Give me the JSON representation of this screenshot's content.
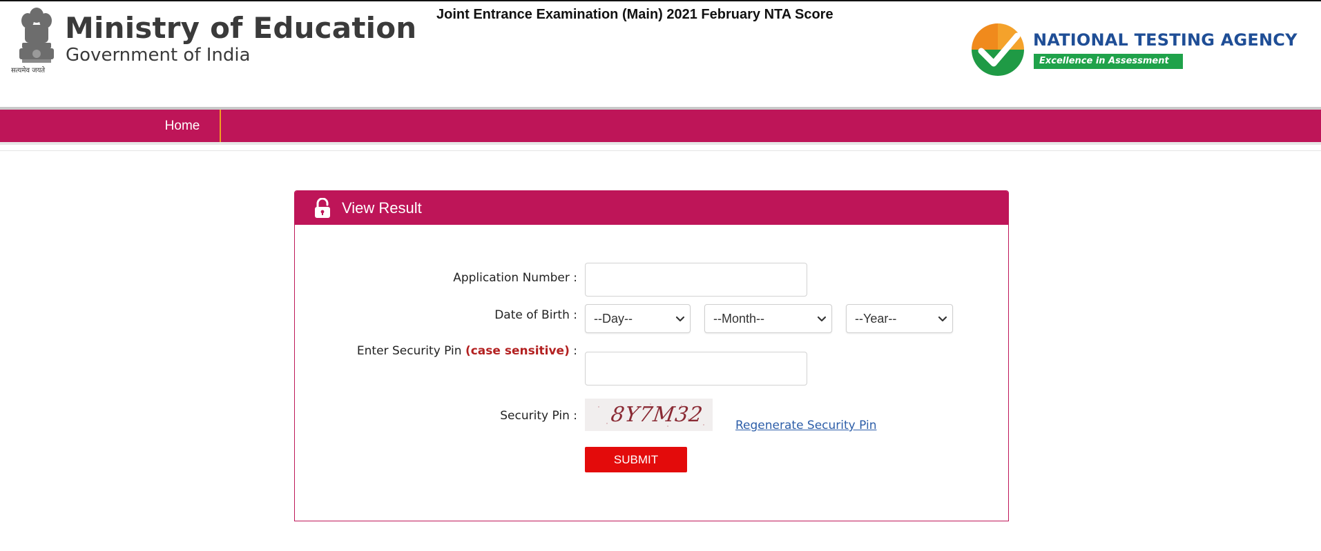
{
  "header": {
    "ministry_title": "Ministry of Education",
    "ministry_subtitle": "Government of India",
    "emblem_motto": "सत्यमेव जयते",
    "exam_title": "Joint Entrance Examination (Main) 2021 February NTA Score",
    "agency_name": "NATIONAL TESTING AGENCY",
    "agency_tagline": "Excellence in Assessment",
    "emblem_icon": "state-emblem-icon",
    "agency_logo_icon": "nta-check-logo-icon"
  },
  "nav": {
    "items": [
      {
        "label": "Home"
      }
    ]
  },
  "panel": {
    "title": "View Result",
    "lock_icon": "lock-icon",
    "fields": {
      "application_number_label": "Application Number :",
      "application_number_value": "",
      "dob_label": "Date of Birth :",
      "dob_day": "--Day--",
      "dob_month": "--Month--",
      "dob_year": "--Year--",
      "security_pin_label_prefix": "Enter Security Pin ",
      "security_pin_label_case": "(case sensitive)",
      "security_pin_label_suffix": " :",
      "security_pin_value": "",
      "captcha_label": "Security Pin :",
      "captcha_text": "8Y7M32",
      "regenerate_label": "Regenerate Security Pin",
      "submit_label": "SUBMIT"
    }
  },
  "colors": {
    "brand": "#be1558",
    "submit": "#e30b0b",
    "agency_blue": "#1f4e96",
    "agency_green": "#1fa24a",
    "link": "#2c5da8"
  }
}
